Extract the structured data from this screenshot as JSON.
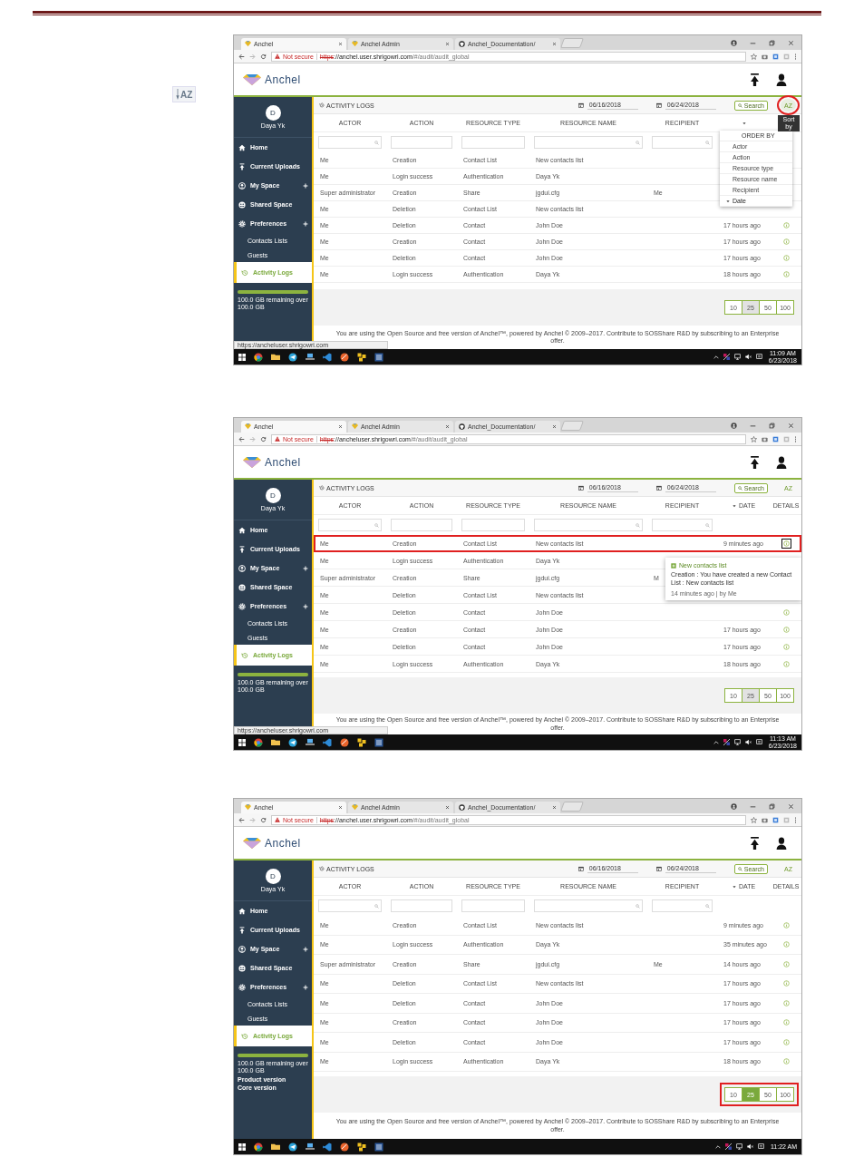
{
  "document": {
    "side_icon": "AZ",
    "screens": [
      {
        "browser": {
          "tabs": [
            {
              "title": "Anchel",
              "selected": true
            },
            {
              "title": "Anchel Admin",
              "selected": false
            },
            {
              "title": "Anchel_Documentation/",
              "selected": false
            }
          ],
          "address": {
            "warning": "Not secure",
            "scheme": "https",
            "host": "://anchel.user.shrigowri.com",
            "path": "/#/audit/audit_global"
          }
        },
        "logo": "Anchel",
        "user": {
          "initial": "D",
          "name": "Daya Yk"
        },
        "nav": [
          {
            "label": "Home",
            "kind": "main",
            "expandable": false,
            "selected": false
          },
          {
            "label": "Current Uploads",
            "kind": "main",
            "expandable": false,
            "selected": false
          },
          {
            "label": "My Space",
            "kind": "main",
            "expandable": true,
            "selected": false
          },
          {
            "label": "Shared Space",
            "kind": "main",
            "expandable": false,
            "selected": false
          },
          {
            "label": "Preferences",
            "kind": "main",
            "expandable": true,
            "selected": false
          },
          {
            "label": "Contacts Lists",
            "kind": "sub",
            "selected": false
          },
          {
            "label": "Guests",
            "kind": "sub",
            "selected": false
          },
          {
            "label": "Activity Logs",
            "kind": "main",
            "expandable": false,
            "selected": true
          }
        ],
        "storage": {
          "level": 1,
          "text": "100.0 GB remaining over 100.0 GB"
        },
        "title": "ACTIVITY LOGS",
        "date_from": "06/16/2018",
        "date_to": "06/24/2018",
        "search_button": "Search",
        "sort_button": {
          "glyph": "AZ",
          "highlighted": true
        },
        "tooltip": "Sort by",
        "menu": {
          "heading": "ORDER BY",
          "items": [
            {
              "label": "Actor",
              "selected": false
            },
            {
              "label": "Action",
              "selected": false
            },
            {
              "label": "Resource type",
              "selected": false
            },
            {
              "label": "Resource name",
              "selected": false
            },
            {
              "label": "Recipient",
              "selected": false
            },
            {
              "label": "Date",
              "selected": true
            }
          ]
        },
        "columns": [
          {
            "label": "ACTOR",
            "sorted": false
          },
          {
            "label": "ACTION",
            "sorted": false
          },
          {
            "label": "RESOURCE TYPE",
            "sorted": false
          },
          {
            "label": "RESOURCE NAME",
            "sorted": false
          },
          {
            "label": "RECIPIENT",
            "sorted": false
          },
          {
            "sorted": true
          }
        ],
        "filters": [
          {
            "search_icon": true
          },
          {
            "search_icon": false
          },
          {
            "search_icon": false
          },
          {
            "search_icon": true
          },
          {
            "search_icon": true
          }
        ],
        "rows": [
          {
            "actor": "Me",
            "action": "Creation",
            "resource_type": "Contact List",
            "resource_name": "New contacts list",
            "details": false,
            "highlighted": false
          },
          {
            "actor": "Me",
            "action": "Login success",
            "resource_type": "Authentication",
            "resource_name": "Daya Yk",
            "details": false,
            "highlighted": false
          },
          {
            "actor": "Super administrator",
            "action": "Creation",
            "resource_type": "Share",
            "resource_name": "jgdui.cfg",
            "recipient": "Me",
            "details": false,
            "highlighted": false
          },
          {
            "actor": "Me",
            "action": "Deletion",
            "resource_type": "Contact List",
            "resource_name": "New contacts list",
            "details": false,
            "highlighted": false
          },
          {
            "actor": "Me",
            "action": "Deletion",
            "resource_type": "Contact",
            "resource_name": "John Doe",
            "date": "17 hours ago",
            "details": true,
            "highlighted": false
          },
          {
            "actor": "Me",
            "action": "Creation",
            "resource_type": "Contact",
            "resource_name": "John Doe",
            "date": "17 hours ago",
            "details": true,
            "highlighted": false
          },
          {
            "actor": "Me",
            "action": "Deletion",
            "resource_type": "Contact",
            "resource_name": "John Doe",
            "date": "17 hours ago",
            "details": true,
            "highlighted": false
          },
          {
            "actor": "Me",
            "action": "Login success",
            "resource_type": "Authentication",
            "resource_name": "Daya Yk",
            "date": "18 hours ago",
            "details": true,
            "highlighted": false
          }
        ],
        "page_sizes": [
          {
            "label": "10",
            "selected": false,
            "shaded": false
          },
          {
            "label": "25",
            "selected": false,
            "shaded": true
          },
          {
            "label": "50",
            "selected": false,
            "shaded": false
          },
          {
            "label": "100",
            "selected": false,
            "shaded": false
          }
        ],
        "page_sizes_highlighted": false,
        "footer": "You are using the Open Source and free version of Anchel™, powered by Anchel © 2009–2017. Contribute to SOSShare R&D by subscribing to an Enterprise offer.",
        "status_url": "https://ancheluser.shrigowri.com",
        "taskbar": {
          "time": "11:09 AM",
          "date": "6/23/2018"
        }
      },
      {
        "browser": {
          "tabs": [
            {
              "title": "Anchel",
              "selected": true
            },
            {
              "title": "Anchel Admin",
              "selected": false
            },
            {
              "title": "Anchel_Documentation/",
              "selected": false
            }
          ],
          "address": {
            "warning": "Not secure",
            "scheme": "https",
            "host": "://ancheluser.shrigowri.com",
            "path": "/#/audit/audit_global"
          }
        },
        "logo": "Anchel",
        "user": {
          "initial": "D",
          "name": "Daya Yk"
        },
        "nav": [
          {
            "label": "Home",
            "kind": "main",
            "expandable": false,
            "selected": false
          },
          {
            "label": "Current Uploads",
            "kind": "main",
            "expandable": false,
            "selected": false
          },
          {
            "label": "My Space",
            "kind": "main",
            "expandable": true,
            "selected": false
          },
          {
            "label": "Shared Space",
            "kind": "main",
            "expandable": false,
            "selected": false
          },
          {
            "label": "Preferences",
            "kind": "main",
            "expandable": true,
            "selected": false
          },
          {
            "label": "Contacts Lists",
            "kind": "sub",
            "selected": false
          },
          {
            "label": "Guests",
            "kind": "sub",
            "selected": false
          },
          {
            "label": "Activity Logs",
            "kind": "main",
            "expandable": false,
            "selected": true
          }
        ],
        "storage": {
          "level": 1,
          "text": "100.0 GB remaining over 100.0 GB"
        },
        "title": "ACTIVITY LOGS",
        "date_from": "06/16/2018",
        "date_to": "06/24/2018",
        "search_button": "Search",
        "sort_button": {
          "glyph": "AZ",
          "highlighted": false
        },
        "columns": [
          {
            "label": "ACTOR",
            "sorted": false
          },
          {
            "label": "ACTION",
            "sorted": false
          },
          {
            "label": "RESOURCE TYPE",
            "sorted": false
          },
          {
            "label": "RESOURCE NAME",
            "sorted": false
          },
          {
            "label": "RECIPIENT",
            "sorted": false
          },
          {
            "label": "DATE",
            "sorted": true
          },
          {
            "label": "DETAILS",
            "sorted": false
          }
        ],
        "filters": [
          {
            "search_icon": true
          },
          {
            "search_icon": false
          },
          {
            "search_icon": false
          },
          {
            "search_icon": true
          },
          {
            "search_icon": true
          }
        ],
        "rows": [
          {
            "actor": "Me",
            "action": "Creation",
            "resource_type": "Contact List",
            "resource_name": "New contacts list",
            "date": "9 minutes ago",
            "details": true,
            "highlighted": true
          },
          {
            "actor": "Me",
            "action": "Login success",
            "resource_type": "Authentication",
            "resource_name": "Daya Yk",
            "details": false,
            "highlighted": false
          },
          {
            "actor": "Super administrator",
            "action": "Creation",
            "resource_type": "Share",
            "resource_name": "jgdui.cfg",
            "recipient": "M",
            "details": false,
            "highlighted": false
          },
          {
            "actor": "Me",
            "action": "Deletion",
            "resource_type": "Contact List",
            "resource_name": "New contacts list",
            "details": false,
            "highlighted": false
          },
          {
            "actor": "Me",
            "action": "Deletion",
            "resource_type": "Contact",
            "resource_name": "John Doe",
            "details": true,
            "highlighted": false
          },
          {
            "actor": "Me",
            "action": "Creation",
            "resource_type": "Contact",
            "resource_name": "John Doe",
            "date": "17 hours ago",
            "details": true,
            "highlighted": false
          },
          {
            "actor": "Me",
            "action": "Deletion",
            "resource_type": "Contact",
            "resource_name": "John Doe",
            "date": "17 hours ago",
            "details": true,
            "highlighted": false
          },
          {
            "actor": "Me",
            "action": "Login success",
            "resource_type": "Authentication",
            "resource_name": "Daya Yk",
            "date": "18 hours ago",
            "details": true,
            "highlighted": false
          }
        ],
        "popover": {
          "title": "New contacts list",
          "text": "Creation : You have created a new Contact List : New contacts list",
          "meta": "14 minutes ago | by Me"
        },
        "page_sizes": [
          {
            "label": "10",
            "selected": false,
            "shaded": false
          },
          {
            "label": "25",
            "selected": false,
            "shaded": true
          },
          {
            "label": "50",
            "selected": false,
            "shaded": false
          },
          {
            "label": "100",
            "selected": false,
            "shaded": false
          }
        ],
        "page_sizes_highlighted": false,
        "footer": "You are using the Open Source and free version of Anchel™, powered by Anchel © 2009–2017. Contribute to SOSShare R&D by subscribing to an Enterprise offer.",
        "status_url": "https://ancheluser.shrigowri.com",
        "taskbar": {
          "time": "11:13 AM",
          "date": "6/23/2018"
        }
      },
      {
        "browser": {
          "tabs": [
            {
              "title": "Anchel",
              "selected": true
            },
            {
              "title": "Anchel Admin",
              "selected": false
            },
            {
              "title": "Anchel_Documentation/",
              "selected": false
            }
          ],
          "address": {
            "warning": "Not secure",
            "scheme": "https",
            "host": "://anchel.user.shrigowri.com",
            "path": "/#/audit/audit_global"
          }
        },
        "logo": "Anchel",
        "user": {
          "initial": "D",
          "name": "Daya Yk"
        },
        "nav": [
          {
            "label": "Home",
            "kind": "main",
            "expandable": false,
            "selected": false
          },
          {
            "label": "Current Uploads",
            "kind": "main",
            "expandable": false,
            "selected": false
          },
          {
            "label": "My Space",
            "kind": "main",
            "expandable": true,
            "selected": false
          },
          {
            "label": "Shared Space",
            "kind": "main",
            "expandable": false,
            "selected": false
          },
          {
            "label": "Preferences",
            "kind": "main",
            "expandable": true,
            "selected": false
          },
          {
            "label": "Contacts Lists",
            "kind": "sub",
            "selected": false
          },
          {
            "label": "Guests",
            "kind": "sub",
            "selected": false
          },
          {
            "label": "Activity Logs",
            "kind": "main",
            "expandable": false,
            "selected": true
          }
        ],
        "storage": {
          "level": 1,
          "text": "100.0 GB remaining over 100.0 GB"
        },
        "versions": [
          "Product version",
          "Core version"
        ],
        "title": "ACTIVITY LOGS",
        "date_from": "06/16/2018",
        "date_to": "06/24/2018",
        "search_button": "Search",
        "sort_button": {
          "glyph": "AZ",
          "highlighted": false
        },
        "columns": [
          {
            "label": "ACTOR",
            "sorted": false
          },
          {
            "label": "ACTION",
            "sorted": false
          },
          {
            "label": "RESOURCE TYPE",
            "sorted": false
          },
          {
            "label": "RESOURCE NAME",
            "sorted": false
          },
          {
            "label": "RECIPIENT",
            "sorted": false
          },
          {
            "label": "DATE",
            "sorted": true
          },
          {
            "label": "DETAILS",
            "sorted": false
          }
        ],
        "filters": [
          {
            "search_icon": true
          },
          {
            "search_icon": false
          },
          {
            "search_icon": false
          },
          {
            "search_icon": true
          },
          {
            "search_icon": true
          }
        ],
        "rows": [
          {
            "actor": "Me",
            "action": "Creation",
            "resource_type": "Contact List",
            "resource_name": "New contacts list",
            "date": "9 minutes ago",
            "details": true,
            "highlighted": false
          },
          {
            "actor": "Me",
            "action": "Login success",
            "resource_type": "Authentication",
            "resource_name": "Daya Yk",
            "date": "35 minutes ago",
            "details": true,
            "highlighted": false
          },
          {
            "actor": "Super administrator",
            "action": "Creation",
            "resource_type": "Share",
            "resource_name": "jgdui.cfg",
            "recipient": "Me",
            "date": "14 hours ago",
            "details": true,
            "highlighted": false
          },
          {
            "actor": "Me",
            "action": "Deletion",
            "resource_type": "Contact List",
            "resource_name": "New contacts list",
            "date": "17 hours ago",
            "details": true,
            "highlighted": false
          },
          {
            "actor": "Me",
            "action": "Deletion",
            "resource_type": "Contact",
            "resource_name": "John Doe",
            "date": "17 hours ago",
            "details": true,
            "highlighted": false
          },
          {
            "actor": "Me",
            "action": "Creation",
            "resource_type": "Contact",
            "resource_name": "John Doe",
            "date": "17 hours ago",
            "details": true,
            "highlighted": false
          },
          {
            "actor": "Me",
            "action": "Deletion",
            "resource_type": "Contact",
            "resource_name": "John Doe",
            "date": "17 hours ago",
            "details": true,
            "highlighted": false
          },
          {
            "actor": "Me",
            "action": "Login success",
            "resource_type": "Authentication",
            "resource_name": "Daya Yk",
            "date": "18 hours ago",
            "details": true,
            "highlighted": false
          }
        ],
        "page_sizes": [
          {
            "label": "10",
            "selected": false,
            "shaded": false
          },
          {
            "label": "25",
            "selected": true,
            "shaded": false
          },
          {
            "label": "50",
            "selected": false,
            "shaded": false
          },
          {
            "label": "100",
            "selected": false,
            "shaded": false
          }
        ],
        "page_sizes_highlighted": true,
        "footer": "You are using the Open Source and free version of Anchel™, powered by Anchel © 2009–2017. Contribute to SOSShare R&D by subscribing to an Enterprise offer.",
        "taskbar": {
          "time": "11:22 AM"
        }
      }
    ]
  }
}
